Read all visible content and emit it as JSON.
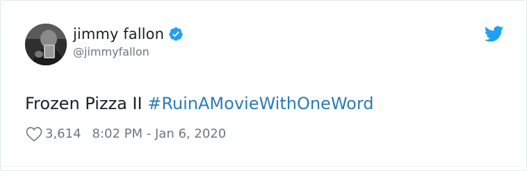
{
  "tweet": {
    "display_name": "jimmy fallon",
    "handle": "@jimmyfallon",
    "text": "Frozen Pizza II ",
    "hashtag": "#RuinAMovieWithOneWord",
    "likes": "3,614",
    "timestamp": "8:02 PM - Jan 6, 2020",
    "verified": true
  },
  "icons": {
    "verified": "verified-badge-icon",
    "bird": "twitter-bird-icon",
    "like": "heart-icon",
    "avatar": "avatar-photo"
  },
  "colors": {
    "link": "#2b7bb9",
    "verified": "#1da1f2",
    "bird": "#1da1f2",
    "text": "#1c2022",
    "muted": "#697882"
  }
}
